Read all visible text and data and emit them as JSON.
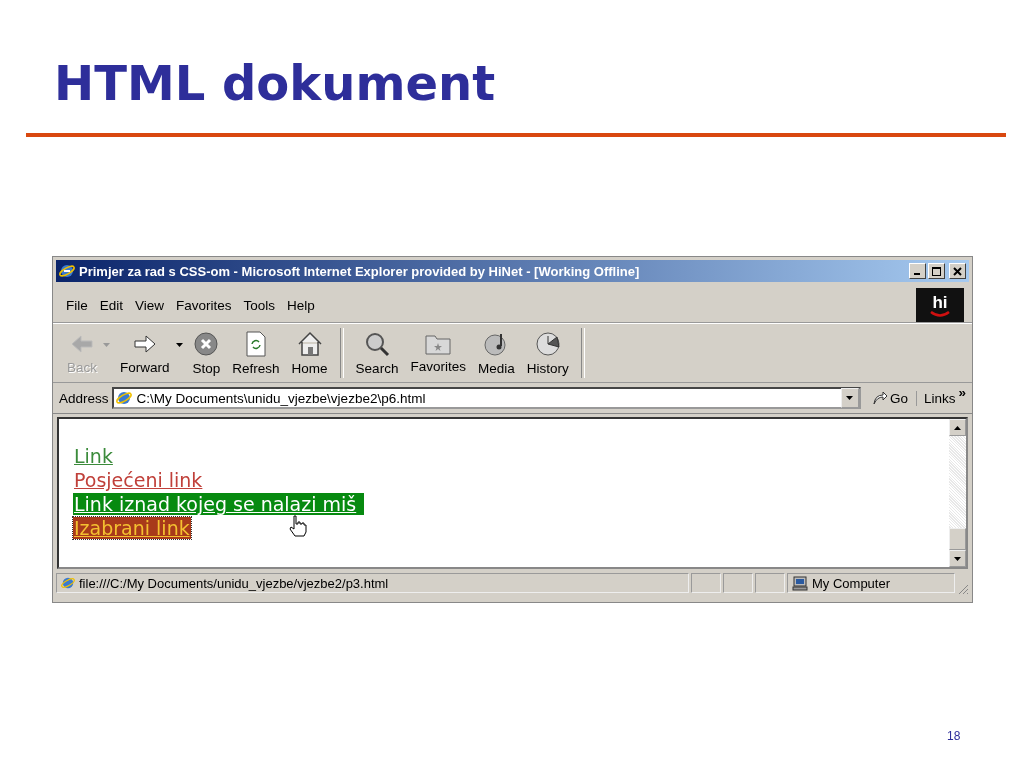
{
  "slide": {
    "title": "HTML dokument",
    "page_number": "18"
  },
  "window": {
    "title": "Primjer za rad s CSS-om - Microsoft Internet Explorer provided by HiNet - [Working Offline]"
  },
  "logo": {
    "text": "hi"
  },
  "menu": [
    {
      "label": "File"
    },
    {
      "label": "Edit"
    },
    {
      "label": "View"
    },
    {
      "label": "Favorites"
    },
    {
      "label": "Tools"
    },
    {
      "label": "Help"
    }
  ],
  "toolbar": {
    "groups": [
      [
        {
          "label": "Back",
          "disabled": true,
          "dropdown": true
        },
        {
          "label": "Forward",
          "disabled": false,
          "dropdown": true
        },
        {
          "label": "Stop",
          "disabled": false,
          "dropdown": false
        },
        {
          "label": "Refresh",
          "disabled": false,
          "dropdown": false
        },
        {
          "label": "Home",
          "disabled": false,
          "dropdown": false
        }
      ],
      [
        {
          "label": "Search",
          "disabled": false,
          "dropdown": false
        },
        {
          "label": "Favorites",
          "disabled": false,
          "dropdown": false
        },
        {
          "label": "Media",
          "disabled": false,
          "dropdown": false
        },
        {
          "label": "History",
          "disabled": false,
          "dropdown": false
        }
      ]
    ]
  },
  "address": {
    "label": "Address",
    "value": "C:\\My Documents\\unidu_vjezbe\\vjezbe2\\p6.html",
    "go": "Go",
    "links": "Links",
    "more": "»"
  },
  "page": {
    "links": [
      {
        "text": "Link",
        "kind": "normal"
      },
      {
        "text": "Posjećeni link",
        "kind": "visited"
      },
      {
        "text": "Link iznad kojeg se nalazi miš",
        "kind": "hover"
      },
      {
        "text": "Izabrani link",
        "kind": "active"
      }
    ]
  },
  "status_bar": {
    "text": "file:///C:/My Documents/unidu_vjezbe/vjezbe2/p3.html",
    "zone": "My Computer"
  }
}
